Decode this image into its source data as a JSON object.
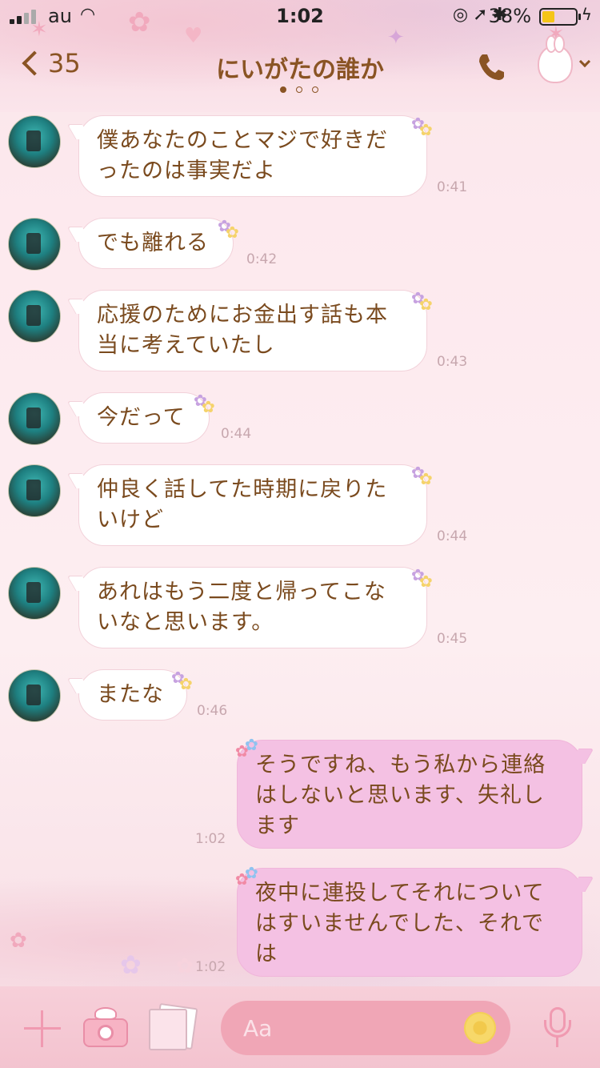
{
  "status_bar": {
    "carrier": "au",
    "time": "1:02",
    "battery_percent": "38%",
    "battery_level": 0.38
  },
  "header": {
    "back_count": "35",
    "title": "にいがたの誰か",
    "page_dots": 3,
    "active_dot": 0
  },
  "messages": [
    {
      "side": "in",
      "lines": [
        "僕あなたのことマジで好きだ",
        "ったのは事実だよ"
      ],
      "time": "0:41"
    },
    {
      "side": "in",
      "lines": [
        "でも離れる"
      ],
      "time": "0:42"
    },
    {
      "side": "in",
      "lines": [
        "応援のためにお金出す話も本",
        "当に考えていたし"
      ],
      "time": "0:43"
    },
    {
      "side": "in",
      "lines": [
        "今だって"
      ],
      "time": "0:44"
    },
    {
      "side": "in",
      "lines": [
        "仲良く話してた時期に戻りた",
        "いけど"
      ],
      "time": "0:44"
    },
    {
      "side": "in",
      "lines": [
        "あれはもう二度と帰ってこな",
        "いなと思います。"
      ],
      "time": "0:45"
    },
    {
      "side": "in",
      "lines": [
        "またな"
      ],
      "time": "0:46"
    },
    {
      "side": "out",
      "lines": [
        "そうですね、もう私から連絡",
        "はしないと思います、失礼し",
        "ます"
      ],
      "time": "1:02"
    },
    {
      "side": "out",
      "lines": [
        "夜中に連投してそれについて",
        "はすいませんでした、それで",
        "は"
      ],
      "time": "1:02"
    }
  ],
  "input": {
    "placeholder": "Aa"
  },
  "icons": {
    "back": "chevron-left-icon",
    "call": "phone-icon",
    "menu": "chevron-down-icon",
    "add": "plus-icon",
    "camera": "camera-icon",
    "album": "photo-icon",
    "sticker": "sticker-icon",
    "mic": "microphone-icon"
  },
  "colors": {
    "accent_brown": "#8a5424",
    "incoming_bubble": "#ffffff",
    "outgoing_bubble": "#f4c1e3",
    "input_bg": "#f0a6b6"
  }
}
